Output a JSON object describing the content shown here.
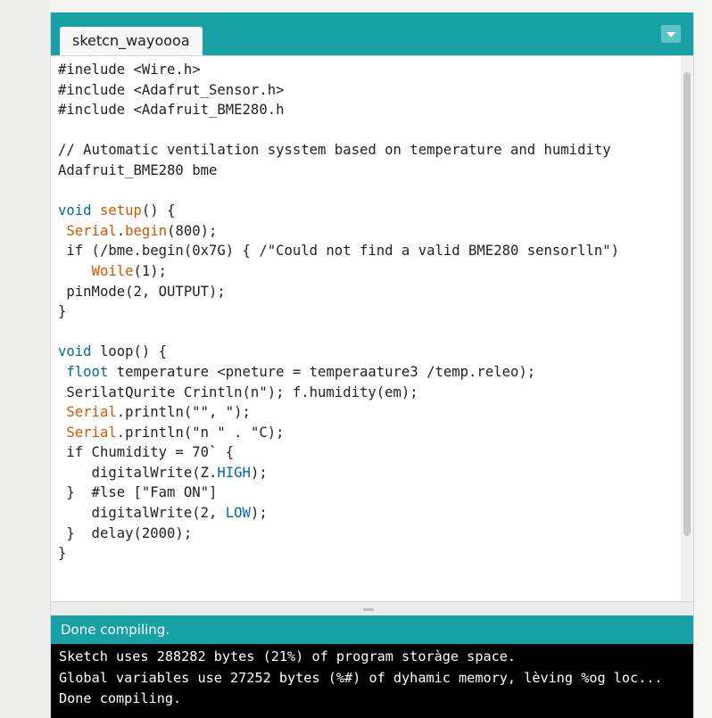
{
  "tab": {
    "title": "sketcn_wayoooa"
  },
  "editor": {
    "lines": [
      [
        {
          "t": "#inelude <Wire.h>"
        }
      ],
      [
        {
          "t": "#include <Adafrut_Sensor.h>"
        }
      ],
      [
        {
          "t": "#include <Adafruit_BME280.h"
        }
      ],
      [
        {
          "t": ""
        }
      ],
      [
        {
          "t": "// Automatic ventilation sysstem based on temperature and humidity"
        }
      ],
      [
        {
          "t": "Adafruit_BME280 bme"
        }
      ],
      [
        {
          "t": ""
        }
      ],
      [
        {
          "t": "void",
          "c": "kw-blue"
        },
        {
          "t": " "
        },
        {
          "t": "setup",
          "c": "kw-orange"
        },
        {
          "t": "() {"
        }
      ],
      [
        {
          "t": " "
        },
        {
          "t": "Serial",
          "c": "kw-orange"
        },
        {
          "t": "."
        },
        {
          "t": "begin",
          "c": "kw-orange"
        },
        {
          "t": "(800);"
        }
      ],
      [
        {
          "t": " if (/bme.begin(0x7G) { /\"Could not find a valid BME280 sensorlln\")"
        }
      ],
      [
        {
          "t": "    "
        },
        {
          "t": "Woile",
          "c": "kw-orange"
        },
        {
          "t": "(1);"
        }
      ],
      [
        {
          "t": " pinMode(2, OUTPUT);"
        }
      ],
      [
        {
          "t": "}"
        }
      ],
      [
        {
          "t": ""
        }
      ],
      [
        {
          "t": "void",
          "c": "kw-blue"
        },
        {
          "t": " loop() {"
        }
      ],
      [
        {
          "t": " "
        },
        {
          "t": "floot",
          "c": "kw-blue"
        },
        {
          "t": " temperature <pneture = temperaature3 /temp.releo);"
        }
      ],
      [
        {
          "t": " SerilatQurite Crintln(n\"); f.humidity(em);"
        }
      ],
      [
        {
          "t": " "
        },
        {
          "t": "Serial",
          "c": "kw-orange"
        },
        {
          "t": ".println(\"\", \");"
        }
      ],
      [
        {
          "t": " "
        },
        {
          "t": "Serial",
          "c": "kw-orange"
        },
        {
          "t": ".println(\"n \" . \"C);"
        }
      ],
      [
        {
          "t": " if Chumidity = 70` {"
        }
      ],
      [
        {
          "t": "    digitalWrite(Z."
        },
        {
          "t": "HIGH",
          "c": "kw-blue"
        },
        {
          "t": ");"
        }
      ],
      [
        {
          "t": " }  #lse [\"Fam ON\"]"
        }
      ],
      [
        {
          "t": "    digitalWrite(2, "
        },
        {
          "t": "LOW",
          "c": "kw-blue"
        },
        {
          "t": ");"
        }
      ],
      [
        {
          "t": " }  delay(2000);"
        }
      ],
      [
        {
          "t": "}"
        }
      ]
    ]
  },
  "status": {
    "text": "Done compiling."
  },
  "console": {
    "lines": [
      "Sketch uses 288282 bytes (21%) of program storàge space.",
      "Global variables use 27252 bytes (%#) of dyhamic memory, lèving %og loc...",
      "Done compiling."
    ]
  },
  "colors": {
    "accent": "#17a1a5",
    "keyword_orange": "#d35400",
    "keyword_blue": "#0068a6",
    "console_bg": "#000000"
  }
}
